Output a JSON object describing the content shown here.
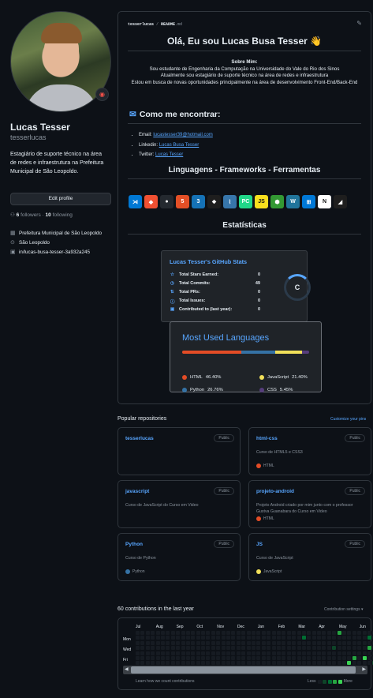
{
  "profile": {
    "name": "Lucas Tesser",
    "login": "tesserlucas",
    "bio": "Estagiário de suporte técnico na área de redes e infraestrutura na Prefeitura Municipal de São Leopoldo.",
    "edit_label": "Edit profile",
    "followers_count": "6",
    "followers_label": "followers",
    "following_count": "10",
    "following_label": "following",
    "separator": "·",
    "organization": "Prefeitura Municipal de São Leopoldo",
    "location": "São Leopoldo",
    "linkedin": "in/lucas-busa-tesser-3a932a245"
  },
  "readme": {
    "path_user": "tesserlucas",
    "path_sep": " / ",
    "path_file": "README",
    "path_ext": ".md",
    "hello": "Olá, Eu sou Lucas Busa Tesser 👋",
    "about_title": "Sobre Mim:",
    "about_lines": [
      "Sou estudante de Engenharia da Computação na Universidade do Vale do Rio dos Sinos",
      "Atualmente sou estagiário de suporte técnico na área de redes e infraestrutura",
      "Estou em busca de novas oportunidades principalmente na área de desenvolvimento Front-End/Back-End"
    ],
    "contact_title": "Como me encontrar:",
    "contacts": [
      {
        "label": "Email: ",
        "value": "lucastesser39@hotmail.com"
      },
      {
        "label": "Linkedin: ",
        "value": "Lucas Busa Tesser"
      },
      {
        "label": "Twitter: ",
        "value": "Lucas Tesser"
      }
    ],
    "langs_title": "Linguagens - Frameworks - Ferramentas",
    "techs": [
      {
        "name": "vscode-icon",
        "glyph": "⋊",
        "color": "#0078d4"
      },
      {
        "name": "git-icon",
        "glyph": "◆",
        "color": "#f05032"
      },
      {
        "name": "github-icon",
        "glyph": "●",
        "color": "#24292f"
      },
      {
        "name": "html5-icon",
        "glyph": "5",
        "color": "#e34f26"
      },
      {
        "name": "css3-icon",
        "glyph": "3",
        "color": "#1572b6"
      },
      {
        "name": "figma-icon",
        "glyph": "❖",
        "color": "#1e1e1e"
      },
      {
        "name": "python-icon",
        "glyph": "⌇",
        "color": "#3776ab"
      },
      {
        "name": "pycharm-icon",
        "glyph": "PC",
        "color": "#21d789"
      },
      {
        "name": "javascript-icon",
        "glyph": "JS",
        "color": "#f7df1e"
      },
      {
        "name": "nodejs-icon",
        "glyph": "⬢",
        "color": "#339933"
      },
      {
        "name": "wordpress-icon",
        "glyph": "W",
        "color": "#21759b"
      },
      {
        "name": "windows-icon",
        "glyph": "⊞",
        "color": "#0078d6"
      },
      {
        "name": "notion-icon",
        "glyph": "N",
        "color": "#ffffff"
      },
      {
        "name": "mysql-icon",
        "glyph": "◢",
        "color": "#1e1e1e"
      }
    ],
    "stats_section": "Estatísticas",
    "stats": {
      "title": "Lucas Tesser's GitHub Stats",
      "rows": [
        {
          "label": "Total Stars Earned:",
          "value": "0",
          "icon": "☆"
        },
        {
          "label": "Total Commits:",
          "value": "49",
          "icon": "◷"
        },
        {
          "label": "Total PRs:",
          "value": "0",
          "icon": "⇅"
        },
        {
          "label": "Total Issues:",
          "value": "0",
          "icon": "ⓘ"
        },
        {
          "label": "Contributed to (last year):",
          "value": "0",
          "icon": "▣"
        }
      ],
      "rank": "C",
      "accent": "#58a6ff"
    },
    "languages": {
      "title": "Most Used Languages",
      "items": [
        {
          "name": "HTML",
          "percent": 46.4,
          "label": "46.40%",
          "color": "#e34c26"
        },
        {
          "name": "Python",
          "percent": 26.76,
          "label": "26.76%",
          "color": "#3572a5"
        },
        {
          "name": "JavaScript",
          "percent": 21.4,
          "label": "21.40%",
          "color": "#f1e05a"
        },
        {
          "name": "CSS",
          "percent": 5.45,
          "label": "5.45%",
          "color": "#563d7c"
        }
      ]
    }
  },
  "repos": {
    "title": "Popular repositories",
    "customize": "Customize your pins",
    "items": [
      {
        "name": "tesserlucas",
        "badge": "Public",
        "desc": "",
        "lang": "",
        "color": ""
      },
      {
        "name": "html-css",
        "badge": "Public",
        "desc": "Curso de HTML5 e CSS3",
        "lang": "HTML",
        "color": "#e34c26"
      },
      {
        "name": "javascript",
        "badge": "Public",
        "desc": "Curso de JavaScript do Curso em Video",
        "lang": "",
        "color": ""
      },
      {
        "name": "projeto-android",
        "badge": "Public",
        "desc": "Projeto Android criado por mim junto com o professor Gustva Guanabara do Curso em Video",
        "lang": "HTML",
        "color": "#e34c26"
      },
      {
        "name": "Python",
        "badge": "Public",
        "desc": "Curso de Python",
        "lang": "Python",
        "color": "#3572a5"
      },
      {
        "name": "JS",
        "badge": "Public",
        "desc": "Curso de JavaScript",
        "lang": "JavaScript",
        "color": "#f1e05a"
      }
    ]
  },
  "contributions": {
    "title": "60 contributions in the last year",
    "settings": "Contribution settings ▾",
    "months": [
      "Jul",
      "Aug",
      "Sep",
      "Oct",
      "Nov",
      "Dec",
      "Jan",
      "Feb",
      "Mar",
      "Apr",
      "May",
      "Jun"
    ],
    "days": [
      "Mon",
      "Wed",
      "Fri"
    ],
    "learn": "Learn how we count contributions",
    "less": "Less",
    "more": "More",
    "levels": [
      "#161b22",
      "#0e4429",
      "#006d32",
      "#26a641",
      "#39d353"
    ]
  }
}
